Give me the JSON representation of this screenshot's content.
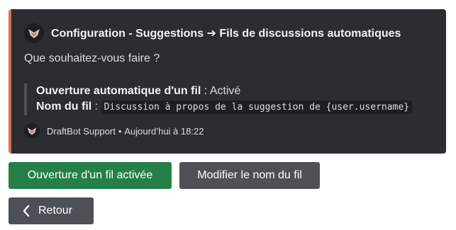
{
  "colors": {
    "accent": "#dd6f52",
    "success": "#248046",
    "secondary": "#4e5058"
  },
  "embed": {
    "author_icon": "draftbot-logo-icon",
    "author": "Configuration - Suggestions ➔ Fils de discussions automatiques",
    "description": "Que souhaitez-vous faire ?",
    "fields": [
      {
        "name": "Ouverture automatique d'un fil",
        "separator": " : ",
        "value": "Activé"
      },
      {
        "name": "Nom du fil",
        "separator": " : ",
        "value": "Discussion à propos de la suggestion de {user.username}"
      }
    ],
    "footer": {
      "icon": "draftbot-logo-icon",
      "text": "DraftBot Support",
      "dot": "•",
      "timestamp": "Aujourd’hui à 18:22"
    }
  },
  "buttons": {
    "thread_toggle": "Ouverture d'un fil activée",
    "rename_thread": "Modifier le nom du fil",
    "back": "Retour",
    "back_icon": "chevron-left-icon"
  }
}
